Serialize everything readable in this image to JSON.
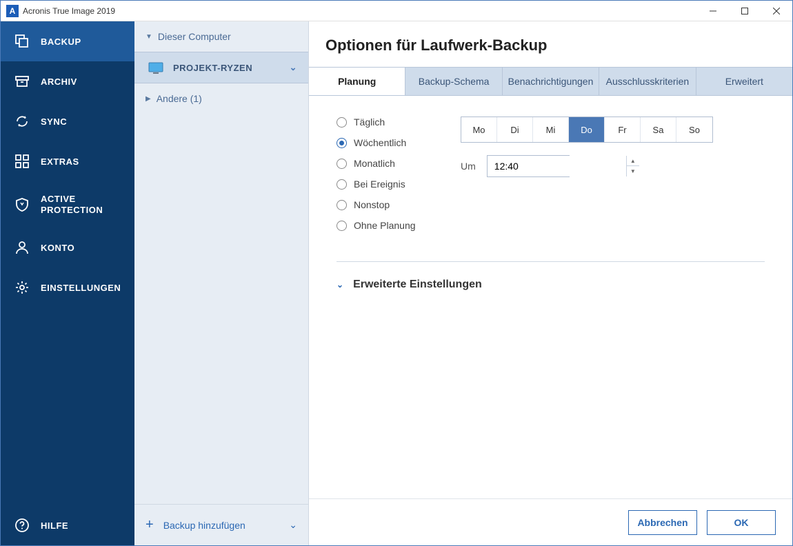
{
  "window": {
    "title": "Acronis True Image 2019"
  },
  "sidebar": {
    "items": [
      {
        "label": "BACKUP"
      },
      {
        "label": "ARCHIV"
      },
      {
        "label": "SYNC"
      },
      {
        "label": "EXTRAS"
      },
      {
        "label": "ACTIVE PROTECTION"
      },
      {
        "label": "KONTO"
      },
      {
        "label": "EINSTELLUNGEN"
      }
    ],
    "help": "HILFE"
  },
  "tree": {
    "group_label": "Dieser Computer",
    "device_name": "PROJEKT-RYZEN",
    "other_label": "Andere (1)",
    "add_backup": "Backup hinzufügen"
  },
  "main": {
    "heading": "Optionen für Laufwerk-Backup",
    "tabs": [
      "Planung",
      "Backup-Schema",
      "Benachrichtigungen",
      "Ausschlusskriterien",
      "Erweitert"
    ],
    "freq_options": [
      "Täglich",
      "Wöchentlich",
      "Monatlich",
      "Bei Ereignis",
      "Nonstop",
      "Ohne Planung"
    ],
    "selected_freq_index": 1,
    "days": [
      "Mo",
      "Di",
      "Mi",
      "Do",
      "Fr",
      "Sa",
      "So"
    ],
    "selected_day_index": 3,
    "time_label": "Um",
    "time_value": "12:40",
    "advanced_label": "Erweiterte Einstellungen"
  },
  "footer": {
    "cancel": "Abbrechen",
    "ok": "OK"
  }
}
